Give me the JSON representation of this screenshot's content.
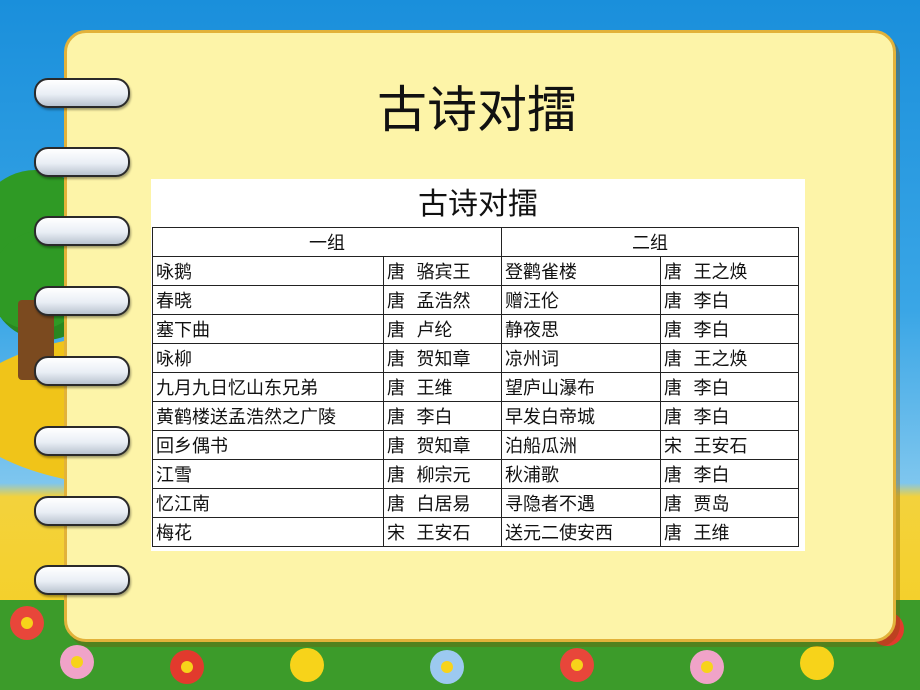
{
  "slide": {
    "title": "古诗对擂"
  },
  "table": {
    "title": "古诗对擂",
    "groups": [
      "一组",
      "二组"
    ],
    "rows": [
      [
        "咏鹅",
        "唐  骆宾王",
        "登鹳雀楼",
        "唐  王之焕"
      ],
      [
        "春晓",
        "唐  孟浩然",
        "赠汪伦",
        "唐  李白"
      ],
      [
        "塞下曲",
        "唐  卢纶",
        "静夜思",
        "唐  李白"
      ],
      [
        "咏柳",
        "唐  贺知章",
        "凉州词",
        "唐  王之焕"
      ],
      [
        "九月九日忆山东兄弟",
        "唐  王维",
        "望庐山瀑布",
        "唐  李白"
      ],
      [
        "黄鹤楼送孟浩然之广陵",
        "唐  李白",
        "早发白帝城",
        "唐  李白"
      ],
      [
        "回乡偶书",
        "唐  贺知章",
        "泊船瓜洲",
        "宋  王安石"
      ],
      [
        "江雪",
        "唐  柳宗元",
        "秋浦歌",
        "唐  李白"
      ],
      [
        "忆江南",
        "唐  白居易",
        "寻隐者不遇",
        "唐  贾岛"
      ],
      [
        "梅花",
        "宋  王安石",
        "送元二使安西",
        "唐  王维"
      ]
    ]
  },
  "colors": {
    "card": "#fdf4a8",
    "card_border": "#e2b23a",
    "sky": "#1a8fdb"
  },
  "icons": {
    "binder": "binder-ring-icon",
    "decor": "flower-icon"
  }
}
